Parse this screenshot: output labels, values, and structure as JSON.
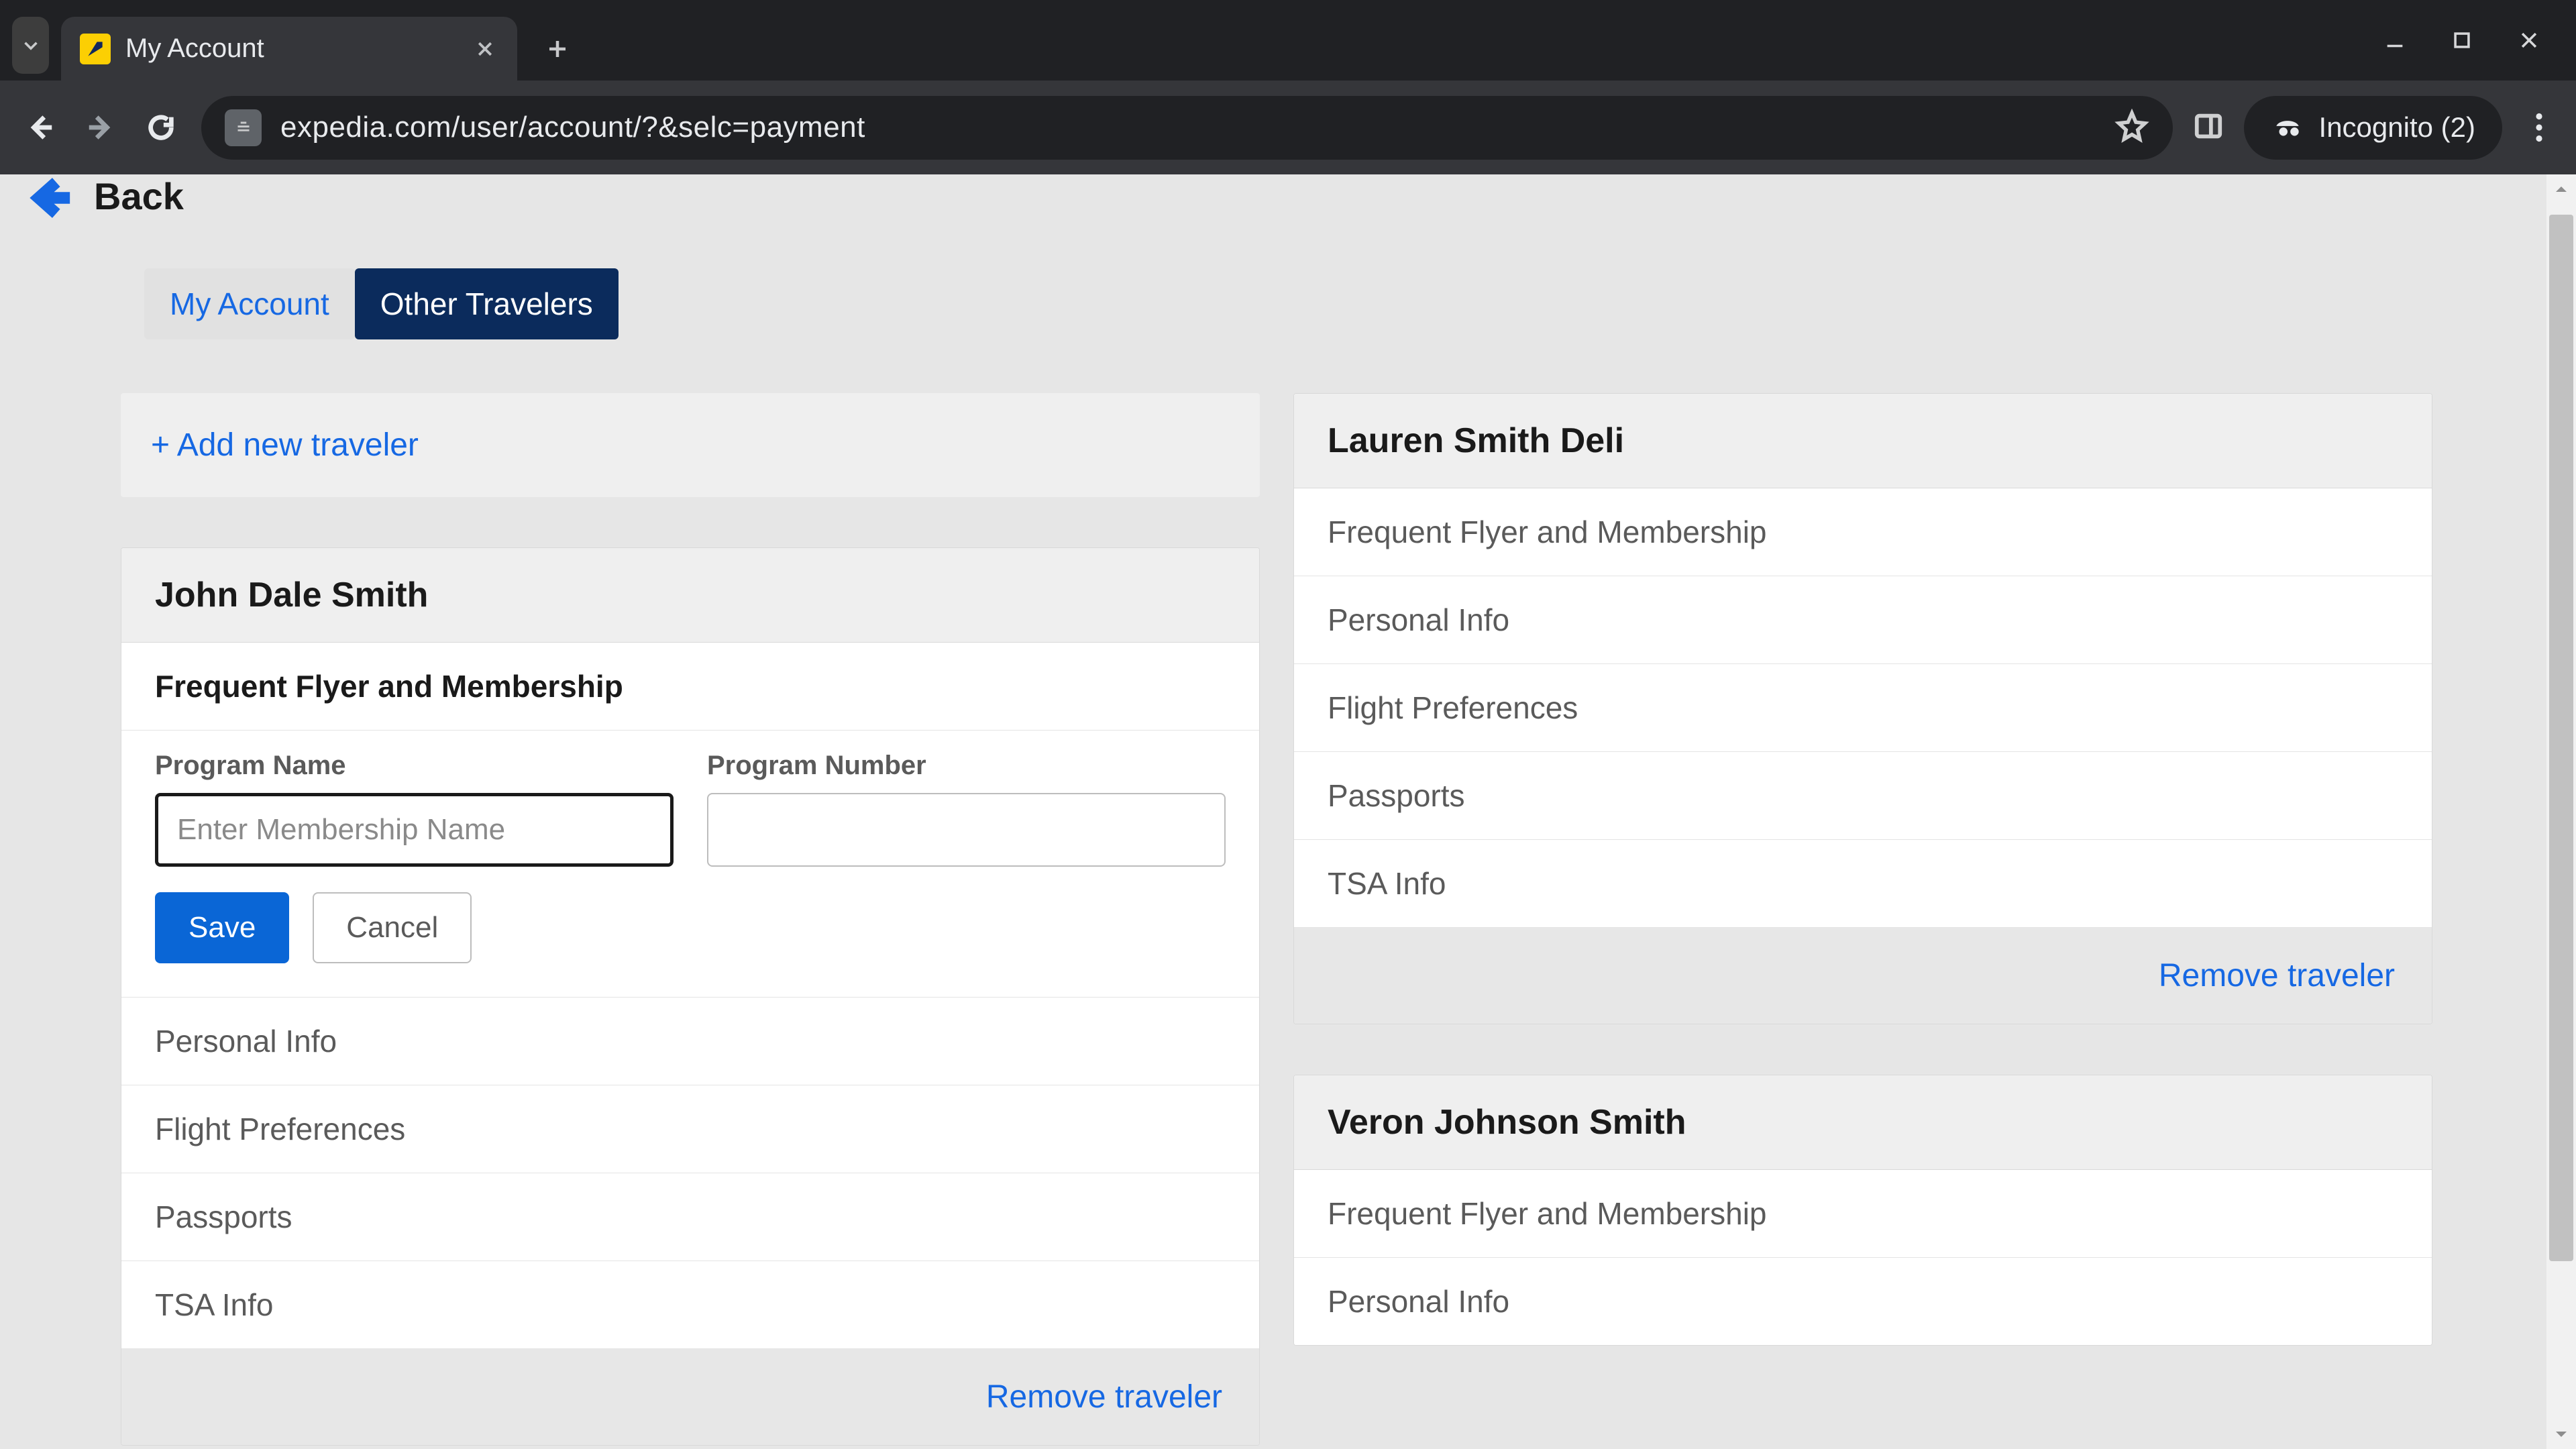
{
  "browser": {
    "tab_title": "My Account",
    "url": "expedia.com/user/account/?&selc=payment",
    "incognito_label": "Incognito (2)"
  },
  "page": {
    "back_label": "Back",
    "tabs": {
      "my_account": "My Account",
      "other_travelers": "Other Travelers"
    },
    "add_traveler_link": "+ Add new traveler",
    "remove_traveler_label": "Remove traveler",
    "section_labels": {
      "ffm": "Frequent Flyer and Membership",
      "personal": "Personal Info",
      "flight_prefs": "Flight Preferences",
      "passports": "Passports",
      "tsa": "TSA Info"
    },
    "form": {
      "program_name_label": "Program Name",
      "program_name_placeholder": "Enter Membership Name",
      "program_number_label": "Program Number",
      "save_label": "Save",
      "cancel_label": "Cancel"
    },
    "travelers": [
      {
        "name": "John Dale Smith"
      },
      {
        "name": "Lauren Smith Deli"
      },
      {
        "name": "Veron Johnson Smith"
      }
    ]
  }
}
